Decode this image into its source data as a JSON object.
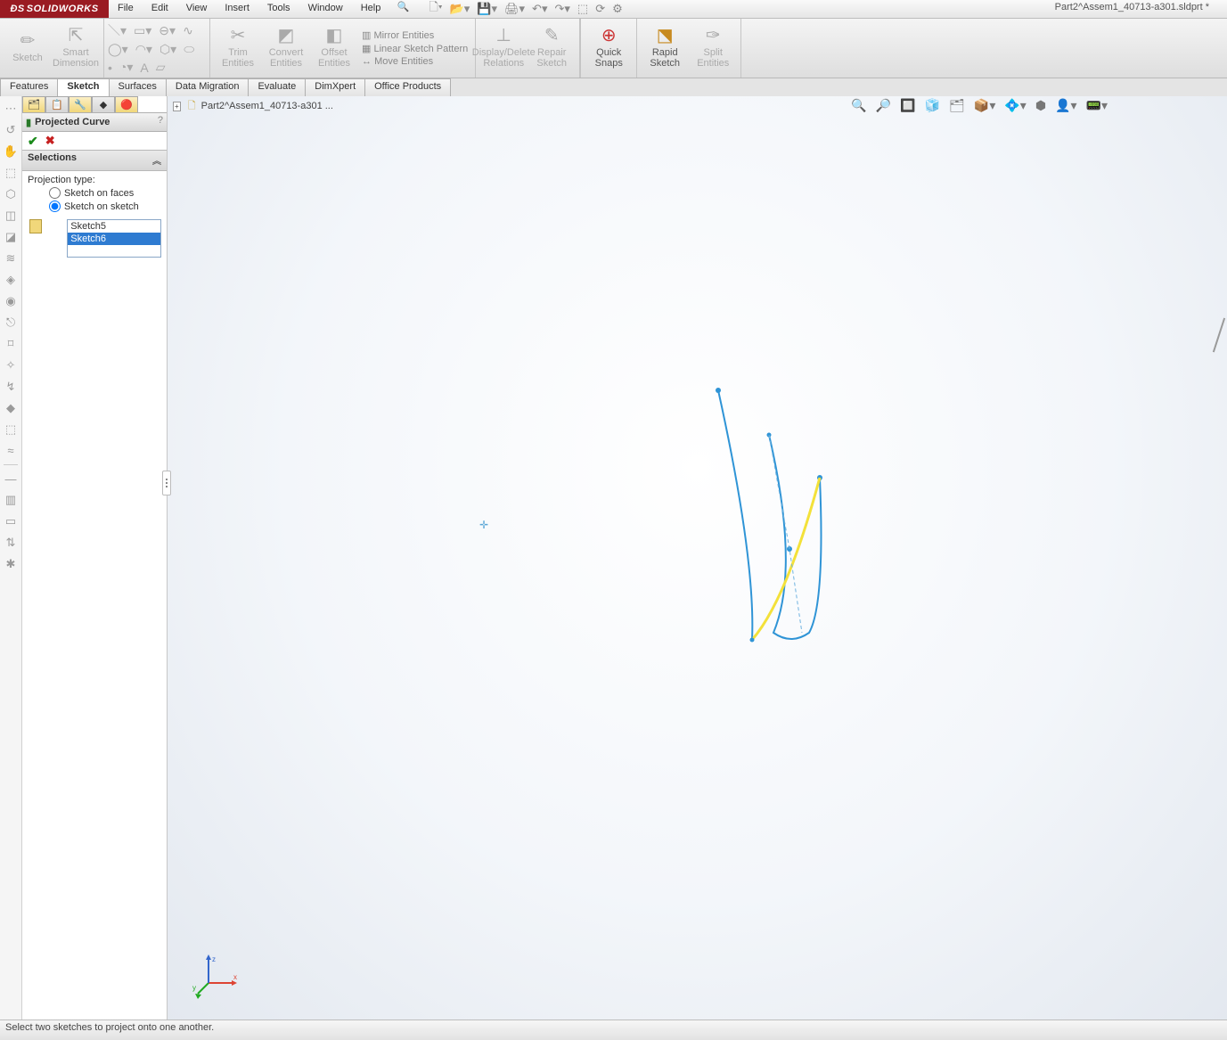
{
  "app": {
    "brand": "SOLIDWORKS",
    "title": "Part2^Assem1_40713-a301.sldprt *"
  },
  "menu": {
    "items": [
      "File",
      "Edit",
      "View",
      "Insert",
      "Tools",
      "Window",
      "Help"
    ]
  },
  "qat": {
    "icons": [
      "new-doc",
      "open-dd",
      "save-dd",
      "print-dd",
      "undo-dd",
      "redo-dd",
      "select",
      "rebuild",
      "options"
    ]
  },
  "ribbon": {
    "groups": [
      {
        "buttons": [
          {
            "label": "Sketch",
            "icon": "✏"
          },
          {
            "label": "Smart\nDimension",
            "icon": "⇱"
          }
        ]
      },
      {
        "small_icons": [
          "line",
          "rect",
          "circle",
          "arc",
          "spline",
          "ellipse",
          "poly",
          "point",
          "slot",
          "chamfer",
          "fillet",
          "text"
        ]
      },
      {
        "buttons": [
          {
            "label": "Trim\nEntities",
            "icon": "✂"
          },
          {
            "label": "Convert\nEntities",
            "icon": "◩"
          },
          {
            "label": "Offset\nEntities",
            "icon": "◧"
          }
        ],
        "stack": [
          "Mirror Entities",
          "Linear Sketch Pattern",
          "Move Entities"
        ]
      },
      {
        "buttons": [
          {
            "label": "Display/Delete\nRelations",
            "icon": "⊥"
          },
          {
            "label": "Repair\nSketch",
            "icon": "✎"
          }
        ]
      },
      {
        "buttons": [
          {
            "label": "Quick\nSnaps",
            "icon": "⊕"
          }
        ],
        "border": true
      },
      {
        "buttons": [
          {
            "label": "Rapid\nSketch",
            "icon": "⬔"
          },
          {
            "label": "Split\nEntities",
            "icon": "✑"
          }
        ]
      }
    ]
  },
  "tabs": {
    "items": [
      "Features",
      "Sketch",
      "Surfaces",
      "Data Migration",
      "Evaluate",
      "DimXpert",
      "Office Products"
    ],
    "active": 1
  },
  "pm": {
    "title": "Projected Curve",
    "section": "Selections",
    "proj_label": "Projection type:",
    "opt_faces": "Sketch on faces",
    "opt_sketch": "Sketch on sketch",
    "sel_items": [
      "Sketch5",
      "Sketch6"
    ],
    "sel_index": 1
  },
  "breadcrumb": "Part2^Assem1_40713-a301 ...",
  "heads_up": [
    "🔍",
    "🔎",
    "🔲",
    "🧊",
    "🗂",
    "📦▾",
    "💠▾",
    "⬢",
    "👤▾",
    "📟▾"
  ],
  "left_tools": [
    "⋯",
    "↺",
    "✋",
    "⬚",
    "⬡",
    "◫",
    "◪",
    "≋",
    "◈",
    "◉",
    "⎋",
    "⌑",
    "✧",
    "↯",
    "◆",
    "⬚",
    "≈",
    "―",
    "▥",
    "▭",
    "⇅",
    "✱",
    "◧"
  ],
  "status": "Select two sketches to project onto one another.",
  "triad": {
    "x": "x",
    "y": "y",
    "z": "z"
  }
}
